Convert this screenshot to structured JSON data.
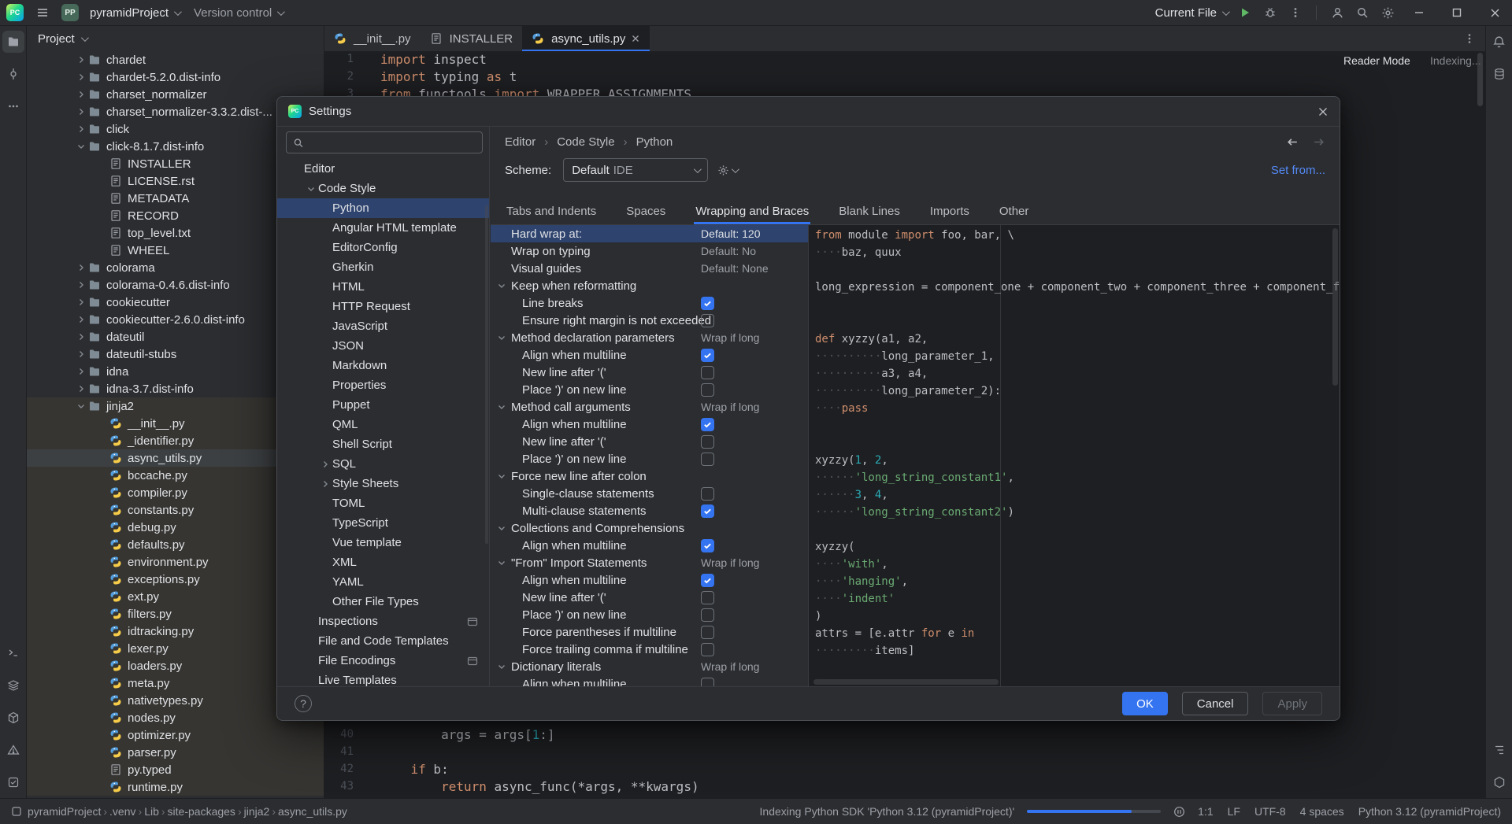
{
  "colors": {
    "accent": "#3574f0",
    "selection": "#2e436e",
    "keyword": "#cf8e6d",
    "string": "#6aab73",
    "number": "#2aacb8"
  },
  "app": {
    "logo_text": "PC"
  },
  "titlebar": {
    "project_badge": "PP",
    "project_name": "pyramidProject",
    "vcs_label": "Version control",
    "run_config": "Current File"
  },
  "project_panel": {
    "header": "Project",
    "tree": [
      {
        "label": "chardet",
        "depth": 0,
        "icon": "folder",
        "chevron": "right"
      },
      {
        "label": "chardet-5.2.0.dist-info",
        "depth": 0,
        "icon": "folder",
        "chevron": "right"
      },
      {
        "label": "charset_normalizer",
        "depth": 0,
        "icon": "folder",
        "chevron": "right"
      },
      {
        "label": "charset_normalizer-3.3.2.dist-...",
        "depth": 0,
        "icon": "folder",
        "chevron": "right"
      },
      {
        "label": "click",
        "depth": 0,
        "icon": "folder",
        "chevron": "right"
      },
      {
        "label": "click-8.1.7.dist-info",
        "depth": 0,
        "icon": "folder",
        "chevron": "down"
      },
      {
        "label": "INSTALLER",
        "depth": 1,
        "icon": "text"
      },
      {
        "label": "LICENSE.rst",
        "depth": 1,
        "icon": "text"
      },
      {
        "label": "METADATA",
        "depth": 1,
        "icon": "text"
      },
      {
        "label": "RECORD",
        "depth": 1,
        "icon": "text"
      },
      {
        "label": "top_level.txt",
        "depth": 1,
        "icon": "text"
      },
      {
        "label": "WHEEL",
        "depth": 1,
        "icon": "text"
      },
      {
        "label": "colorama",
        "depth": 0,
        "icon": "folder",
        "chevron": "right"
      },
      {
        "label": "colorama-0.4.6.dist-info",
        "depth": 0,
        "icon": "folder",
        "chevron": "right"
      },
      {
        "label": "cookiecutter",
        "depth": 0,
        "icon": "folder",
        "chevron": "right"
      },
      {
        "label": "cookiecutter-2.6.0.dist-info",
        "depth": 0,
        "icon": "folder",
        "chevron": "right"
      },
      {
        "label": "dateutil",
        "depth": 0,
        "icon": "folder",
        "chevron": "right"
      },
      {
        "label": "dateutil-stubs",
        "depth": 0,
        "icon": "folder",
        "chevron": "right"
      },
      {
        "label": "idna",
        "depth": 0,
        "icon": "folder",
        "chevron": "right"
      },
      {
        "label": "idna-3.7.dist-info",
        "depth": 0,
        "icon": "folder",
        "chevron": "right"
      },
      {
        "label": "jinja2",
        "depth": 0,
        "icon": "folder",
        "chevron": "down",
        "tint": true
      },
      {
        "label": "__init__.py",
        "depth": 1,
        "icon": "python",
        "tint": true
      },
      {
        "label": "_identifier.py",
        "depth": 1,
        "icon": "python",
        "tint": true
      },
      {
        "label": "async_utils.py",
        "depth": 1,
        "icon": "python",
        "tint": true,
        "selected": true
      },
      {
        "label": "bccache.py",
        "depth": 1,
        "icon": "python",
        "tint": true
      },
      {
        "label": "compiler.py",
        "depth": 1,
        "icon": "python",
        "tint": true
      },
      {
        "label": "constants.py",
        "depth": 1,
        "icon": "python",
        "tint": true
      },
      {
        "label": "debug.py",
        "depth": 1,
        "icon": "python",
        "tint": true
      },
      {
        "label": "defaults.py",
        "depth": 1,
        "icon": "python",
        "tint": true
      },
      {
        "label": "environment.py",
        "depth": 1,
        "icon": "python",
        "tint": true
      },
      {
        "label": "exceptions.py",
        "depth": 1,
        "icon": "python",
        "tint": true
      },
      {
        "label": "ext.py",
        "depth": 1,
        "icon": "python",
        "tint": true
      },
      {
        "label": "filters.py",
        "depth": 1,
        "icon": "python",
        "tint": true
      },
      {
        "label": "idtracking.py",
        "depth": 1,
        "icon": "python",
        "tint": true
      },
      {
        "label": "lexer.py",
        "depth": 1,
        "icon": "python",
        "tint": true
      },
      {
        "label": "loaders.py",
        "depth": 1,
        "icon": "python",
        "tint": true
      },
      {
        "label": "meta.py",
        "depth": 1,
        "icon": "python",
        "tint": true
      },
      {
        "label": "nativetypes.py",
        "depth": 1,
        "icon": "python",
        "tint": true
      },
      {
        "label": "nodes.py",
        "depth": 1,
        "icon": "python",
        "tint": true
      },
      {
        "label": "optimizer.py",
        "depth": 1,
        "icon": "python",
        "tint": true
      },
      {
        "label": "parser.py",
        "depth": 1,
        "icon": "python",
        "tint": true
      },
      {
        "label": "py.typed",
        "depth": 1,
        "icon": "text",
        "tint": true
      },
      {
        "label": "runtime.py",
        "depth": 1,
        "icon": "python",
        "tint": true
      }
    ]
  },
  "editor": {
    "tabs": [
      {
        "label": "__init__.py",
        "icon": "python",
        "active": false
      },
      {
        "label": "INSTALLER",
        "icon": "text",
        "active": false
      },
      {
        "label": "async_utils.py",
        "icon": "python",
        "active": true,
        "closable": true
      }
    ],
    "reader_mode": "Reader Mode",
    "indexing": "Indexing...",
    "code_top": [
      {
        "num": "1",
        "tokens": [
          [
            "kw",
            "import"
          ],
          [
            "pl",
            " inspect"
          ]
        ]
      },
      {
        "num": "2",
        "tokens": [
          [
            "kw",
            "import"
          ],
          [
            "pl",
            " typing "
          ],
          [
            "kw",
            "as"
          ],
          [
            "pl",
            " t"
          ]
        ]
      },
      {
        "num": "3",
        "tokens": [
          [
            "kw",
            "from"
          ],
          [
            "pl",
            " functools "
          ],
          [
            "kw",
            "import"
          ],
          [
            "pl",
            " WRAPPER_ASSIGNMENTS"
          ]
        ]
      }
    ],
    "code_bottom": [
      {
        "num": "40",
        "tokens": [
          [
            "pl",
            "        args = args["
          ],
          [
            "num",
            "1"
          ],
          [
            "pl",
            ":]"
          ]
        ]
      },
      {
        "num": "41",
        "tokens": []
      },
      {
        "num": "42",
        "tokens": [
          [
            "pl",
            "    "
          ],
          [
            "kw",
            "if"
          ],
          [
            "pl",
            " b:"
          ]
        ]
      },
      {
        "num": "43",
        "tokens": [
          [
            "pl",
            "        "
          ],
          [
            "kw",
            "return"
          ],
          [
            "pl",
            " async_func(*args, **kwargs)"
          ]
        ]
      }
    ]
  },
  "dialog": {
    "title": "Settings",
    "search_placeholder": "",
    "nav": [
      {
        "label": "Editor",
        "depth": 0
      },
      {
        "label": "Code Style",
        "depth": 1,
        "chevron": "down"
      },
      {
        "label": "Python",
        "depth": 2,
        "selected": true
      },
      {
        "label": "Angular HTML template",
        "depth": 2
      },
      {
        "label": "EditorConfig",
        "depth": 2
      },
      {
        "label": "Gherkin",
        "depth": 2
      },
      {
        "label": "HTML",
        "depth": 2
      },
      {
        "label": "HTTP Request",
        "depth": 2
      },
      {
        "label": "JavaScript",
        "depth": 2
      },
      {
        "label": "JSON",
        "depth": 2
      },
      {
        "label": "Markdown",
        "depth": 2
      },
      {
        "label": "Properties",
        "depth": 2
      },
      {
        "label": "Puppet",
        "depth": 2
      },
      {
        "label": "QML",
        "depth": 2
      },
      {
        "label": "Shell Script",
        "depth": 2
      },
      {
        "label": "SQL",
        "depth": 2,
        "chevron": "right"
      },
      {
        "label": "Style Sheets",
        "depth": 2,
        "chevron": "right"
      },
      {
        "label": "TOML",
        "depth": 2
      },
      {
        "label": "TypeScript",
        "depth": 2
      },
      {
        "label": "Vue template",
        "depth": 2
      },
      {
        "label": "XML",
        "depth": 2
      },
      {
        "label": "YAML",
        "depth": 2
      },
      {
        "label": "Other File Types",
        "depth": 2
      },
      {
        "label": "Inspections",
        "depth": 1,
        "right_icon": true
      },
      {
        "label": "File and Code Templates",
        "depth": 1
      },
      {
        "label": "File Encodings",
        "depth": 1,
        "right_icon": true
      },
      {
        "label": "Live Templates",
        "depth": 1
      }
    ],
    "breadcrumb": [
      "Editor",
      "Code Style",
      "Python"
    ],
    "scheme_label": "Scheme:",
    "scheme_value": "Default",
    "scheme_suffix": "IDE",
    "set_from": "Set from...",
    "tabs": [
      "Tabs and Indents",
      "Spaces",
      "Wrapping and Braces",
      "Blank Lines",
      "Imports",
      "Other"
    ],
    "active_tab": "Wrapping and Braces",
    "settings": [
      {
        "type": "value",
        "label": "Hard wrap at:",
        "value": "Default: 120",
        "selected": true
      },
      {
        "type": "value",
        "label": "Wrap on typing",
        "value": "Default: No"
      },
      {
        "type": "value",
        "label": "Visual guides",
        "value": "Default: None"
      },
      {
        "type": "group",
        "label": "Keep when reformatting"
      },
      {
        "type": "check",
        "label": "Line breaks",
        "checked": true
      },
      {
        "type": "check",
        "label": "Ensure right margin is not exceeded",
        "checked": false
      },
      {
        "type": "group",
        "label": "Method declaration parameters",
        "value": "Wrap if long"
      },
      {
        "type": "check",
        "label": "Align when multiline",
        "checked": true
      },
      {
        "type": "check",
        "label": "New line after '('",
        "checked": false
      },
      {
        "type": "check",
        "label": "Place ')' on new line",
        "checked": false
      },
      {
        "type": "group",
        "label": "Method call arguments",
        "value": "Wrap if long"
      },
      {
        "type": "check",
        "label": "Align when multiline",
        "checked": true
      },
      {
        "type": "check",
        "label": "New line after '('",
        "checked": false
      },
      {
        "type": "check",
        "label": "Place ')' on new line",
        "checked": false
      },
      {
        "type": "group",
        "label": "Force new line after colon"
      },
      {
        "type": "check",
        "label": "Single-clause statements",
        "checked": false
      },
      {
        "type": "check",
        "label": "Multi-clause statements",
        "checked": true
      },
      {
        "type": "group",
        "label": "Collections and Comprehensions"
      },
      {
        "type": "check",
        "label": "Align when multiline",
        "checked": true
      },
      {
        "type": "group",
        "label": "\"From\" Import Statements",
        "value": "Wrap if long"
      },
      {
        "type": "check",
        "label": "Align when multiline",
        "checked": true
      },
      {
        "type": "check",
        "label": "New line after '('",
        "checked": false
      },
      {
        "type": "check",
        "label": "Place ')' on new line",
        "checked": false
      },
      {
        "type": "check",
        "label": "Force parentheses if multiline",
        "checked": false
      },
      {
        "type": "check",
        "label": "Force trailing comma if multiline",
        "checked": false
      },
      {
        "type": "group",
        "label": "Dictionary literals",
        "value": "Wrap if long"
      },
      {
        "type": "check",
        "label": "Align when multiline",
        "checked": false
      }
    ],
    "preview": [
      {
        "tokens": [
          [
            "kw",
            "from"
          ],
          [
            "pl",
            " module "
          ],
          [
            "kw",
            "import"
          ],
          [
            "pl",
            " foo, bar, \\"
          ]
        ]
      },
      {
        "tokens": [
          [
            "ws",
            "····"
          ],
          [
            "pl",
            "baz, quux"
          ]
        ]
      },
      {
        "tokens": []
      },
      {
        "tokens": [
          [
            "pl",
            "long_expression = component_one + component_two + component_three + component_four +"
          ]
        ]
      },
      {
        "tokens": []
      },
      {
        "tokens": []
      },
      {
        "tokens": [
          [
            "kw",
            "def"
          ],
          [
            "pl",
            " xyzzy(a1, a2,"
          ]
        ]
      },
      {
        "tokens": [
          [
            "ws",
            "··········"
          ],
          [
            "pl",
            "long_parameter_1,"
          ]
        ]
      },
      {
        "tokens": [
          [
            "ws",
            "··········"
          ],
          [
            "pl",
            "a3, a4,"
          ]
        ]
      },
      {
        "tokens": [
          [
            "ws",
            "··········"
          ],
          [
            "pl",
            "long_parameter_2):"
          ]
        ]
      },
      {
        "tokens": [
          [
            "ws",
            "····"
          ],
          [
            "kw",
            "pass"
          ]
        ]
      },
      {
        "tokens": []
      },
      {
        "tokens": []
      },
      {
        "tokens": [
          [
            "pl",
            "xyzzy("
          ],
          [
            "num",
            "1"
          ],
          [
            "pl",
            ", "
          ],
          [
            "num",
            "2"
          ],
          [
            "pl",
            ","
          ]
        ]
      },
      {
        "tokens": [
          [
            "ws",
            "······"
          ],
          [
            "str",
            "'long_string_constant1'"
          ],
          [
            "pl",
            ","
          ]
        ]
      },
      {
        "tokens": [
          [
            "ws",
            "······"
          ],
          [
            "num",
            "3"
          ],
          [
            "pl",
            ", "
          ],
          [
            "num",
            "4"
          ],
          [
            "pl",
            ","
          ]
        ]
      },
      {
        "tokens": [
          [
            "ws",
            "······"
          ],
          [
            "str",
            "'long_string_constant2'"
          ],
          [
            "pl",
            ")"
          ]
        ]
      },
      {
        "tokens": []
      },
      {
        "tokens": [
          [
            "pl",
            "xyzzy("
          ]
        ]
      },
      {
        "tokens": [
          [
            "ws",
            "····"
          ],
          [
            "str",
            "'with'"
          ],
          [
            "pl",
            ","
          ]
        ]
      },
      {
        "tokens": [
          [
            "ws",
            "····"
          ],
          [
            "str",
            "'hanging'"
          ],
          [
            "pl",
            ","
          ]
        ]
      },
      {
        "tokens": [
          [
            "ws",
            "····"
          ],
          [
            "str",
            "'indent'"
          ]
        ]
      },
      {
        "tokens": [
          [
            "pl",
            ")"
          ]
        ]
      },
      {
        "tokens": [
          [
            "pl",
            "attrs = [e.attr "
          ],
          [
            "kw",
            "for"
          ],
          [
            "pl",
            " e "
          ],
          [
            "kw",
            "in"
          ]
        ]
      },
      {
        "tokens": [
          [
            "ws",
            "·········"
          ],
          [
            "pl",
            "items]"
          ]
        ]
      }
    ],
    "help_label": "?",
    "buttons": {
      "ok": "OK",
      "cancel": "Cancel",
      "apply": "Apply"
    }
  },
  "statusbar": {
    "crumbs": [
      "pyramidProject",
      ".venv",
      "Lib",
      "site-packages",
      "jinja2",
      "async_utils.py"
    ],
    "indexing_text": "Indexing Python SDK 'Python 3.12 (pyramidProject)'",
    "items": [
      "1:1",
      "LF",
      "UTF-8",
      "4 spaces",
      "Python 3.12 (pyramidProject)"
    ]
  }
}
